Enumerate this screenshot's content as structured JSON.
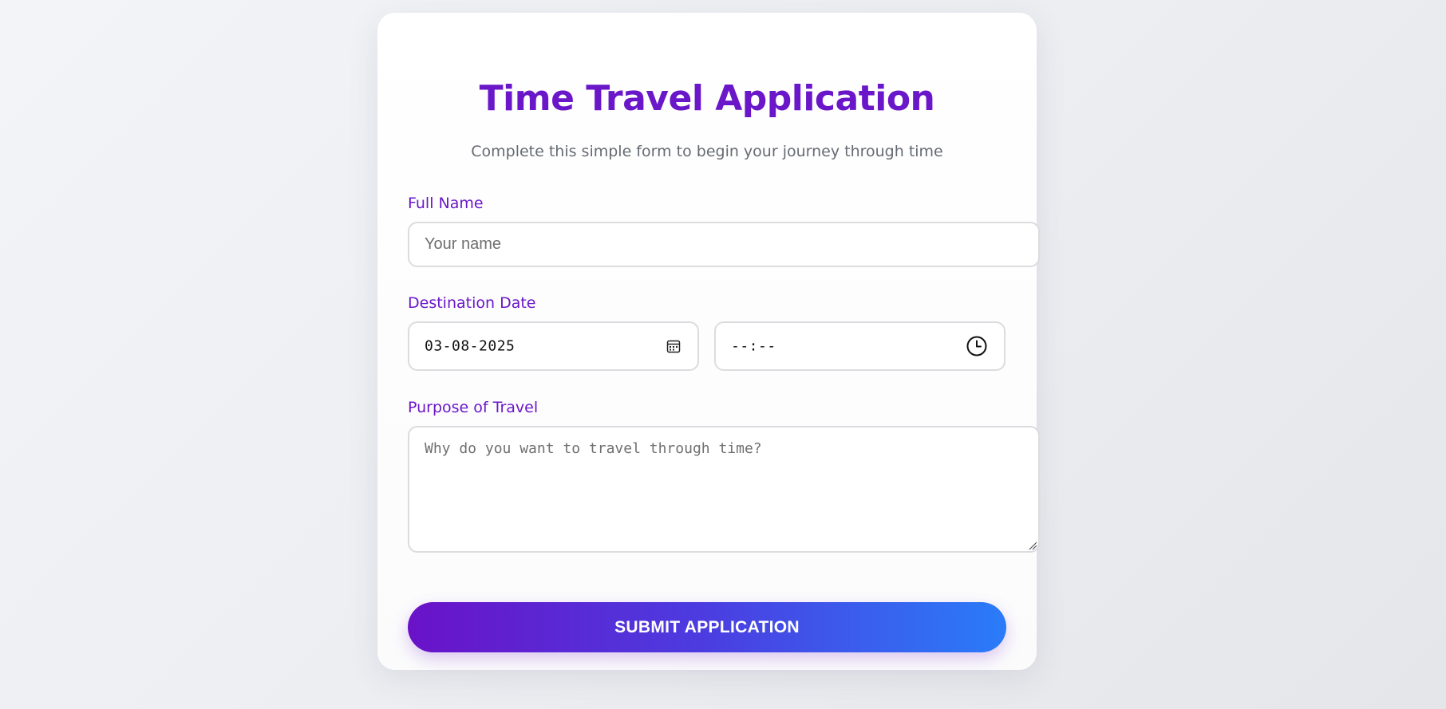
{
  "form": {
    "title": "Time Travel Application",
    "subtitle": "Complete this simple form to begin your journey through time",
    "full_name": {
      "label": "Full Name",
      "placeholder": "Your name",
      "value": ""
    },
    "destination_date": {
      "label": "Destination Date",
      "date_value": "03-08-2025",
      "date_icon": "calendar-icon",
      "time_value": "--:--",
      "time_icon": "clock-icon"
    },
    "purpose": {
      "label": "Purpose of Travel",
      "placeholder": "Why do you want to travel through time?",
      "value": ""
    },
    "submit_label": "SUBMIT APPLICATION"
  },
  "colors": {
    "accent": "#6a16c9",
    "button_gradient_start": "#6a12c8",
    "button_gradient_end": "#2a7cf9",
    "subtitle_text": "#666a72",
    "field_border": "#dcdce0"
  }
}
